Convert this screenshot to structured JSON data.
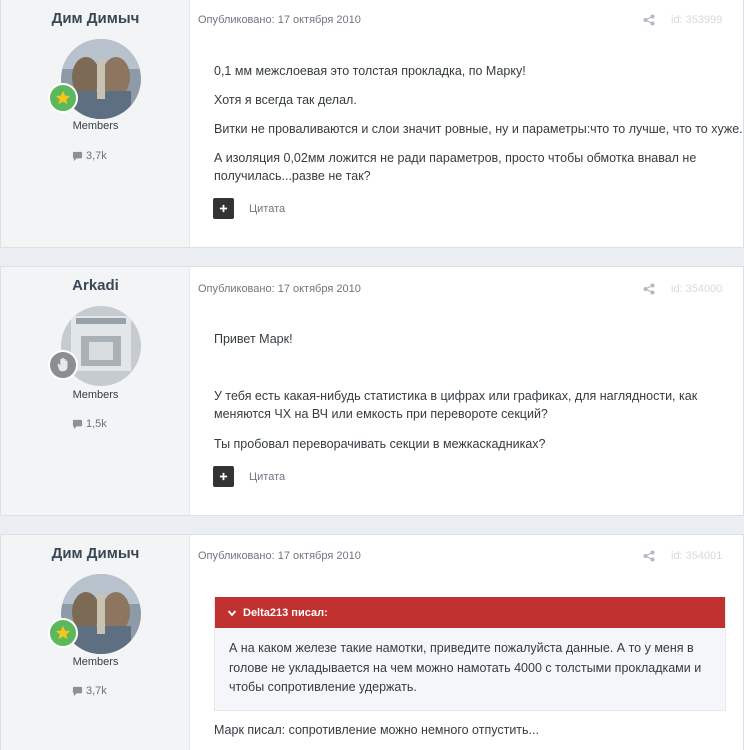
{
  "posts": [
    {
      "author": "Дим Димыч",
      "group": "Members",
      "reputation": "3,7k",
      "meta": "Опубликовано: 17 октября 2010",
      "id": "id: 353999",
      "paragraphs": [
        "0,1 мм межслоевая это толстая прокладка, по Марку!",
        "Хотя я всегда так делал.",
        "Витки не проваливаются и слои значит ровные, ну и параметры:что то лучше, что то хуже...",
        "А изоляция 0,02мм ложится не ради параметров, просто чтобы обмотка внавал не",
        "получилась...разве не так?"
      ],
      "quote_label": "Цитата",
      "rank_icon": "star-icon",
      "rank_color": "#5cb85c"
    },
    {
      "author": "Arkadi",
      "group": "Members",
      "reputation": "1,5k",
      "meta": "Опубликовано: 17 октября 2010",
      "id": "id: 354000",
      "paragraphs": [
        "Привет Марк!",
        "У тебя есть какая-нибудь статистика в цифрах или графиках, для наглядности, как",
        "меняются ЧХ на ВЧ или емкость при перевороте секций?",
        "Ты пробовал переворачивать секции в межкаскадниках?"
      ],
      "quote_label": "Цитата",
      "rank_icon": "hand-icon",
      "rank_color": "#8a8f94"
    },
    {
      "author": "Дим Димыч",
      "group": "Members",
      "reputation": "3,7k",
      "meta": "Опубликовано: 17 октября 2010",
      "id": "id: 354001",
      "citation": {
        "header": "Delta213 писал:",
        "lines": [
          "А на каком железе такие намотки, приведите пожалуйста данные. А то у меня в",
          "голове не укладывается на чем можно намотать 4000 с толстыми прокладками и",
          "чтобы сопротивление удержать."
        ]
      },
      "paragraphs": [
        "Марк писал: сопротивление можно немного отпустить..."
      ],
      "rank_icon": "star-icon",
      "rank_color": "#5cb85c"
    }
  ],
  "colors": {
    "citation_header": "#c0312f",
    "page_background": "#ebeef2"
  }
}
